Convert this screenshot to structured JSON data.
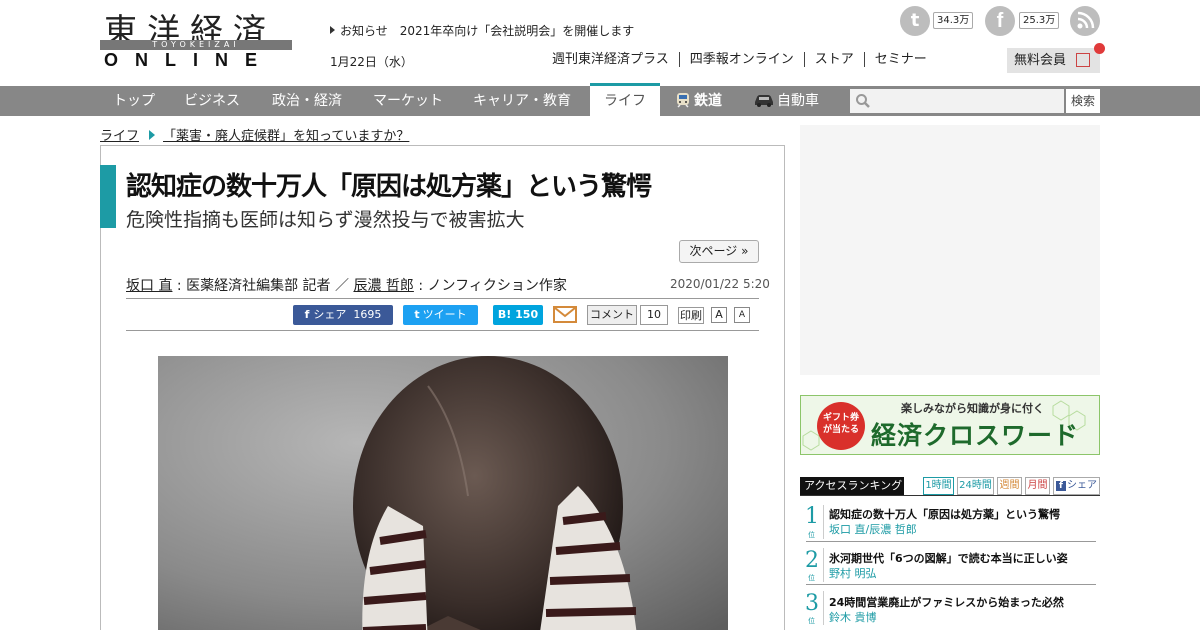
{
  "logo": {
    "kanji": "東洋経済",
    "roman": "TOYOKEIZAI",
    "online": "ONLINE"
  },
  "header": {
    "notice": "お知らせ　2021年卒向け「会社説明会」を開催します",
    "date": "1月22日（水）",
    "links": [
      "週刊東洋経済プラス",
      "四季報オンライン",
      "ストア",
      "セミナー"
    ],
    "member_button": "無料会員"
  },
  "social": [
    {
      "icon": "twitter-icon",
      "count": "34.3万"
    },
    {
      "icon": "facebook-icon",
      "count": "25.3万"
    },
    {
      "icon": "rss-icon",
      "count": ""
    }
  ],
  "nav": {
    "items": [
      "トップ",
      "ビジネス",
      "政治・経済",
      "マーケット",
      "キャリア・教育",
      "ライフ",
      "鉄道",
      "自動車"
    ],
    "active": "ライフ",
    "search_button": "検索"
  },
  "breadcrumb": {
    "section": "ライフ",
    "series": "「薬害・廃人症候群」を知っていますか？"
  },
  "article": {
    "title": "認知症の数十万人「原因は処方薬」という驚愕",
    "subtitle": "危険性指摘も医師は知らず漫然投与で被害拡大",
    "next_page": "次ページ »",
    "author1": "坂口 直",
    "author1_role": "医薬経済社編集部 記者",
    "separator": "／",
    "author2": "辰濃 哲郎",
    "author2_role": "ノンフィクション作家",
    "date": "2020/01/22 5:20"
  },
  "share": {
    "facebook_label": "シェア",
    "facebook_count": "1695",
    "tweet_label": "ツイート",
    "hatena_label": "B!",
    "hatena_count": "150",
    "comment_label": "コメント",
    "comment_count": "10",
    "print_label": "印刷",
    "font_large": "A",
    "font_small": "A"
  },
  "banner": {
    "tagline": "楽しみながら知識が身に付く",
    "badge": "ギフト券が当たる",
    "title": "経済クロスワード"
  },
  "ranking": {
    "header": "アクセスランキング",
    "tabs": [
      "1時間",
      "24時間",
      "週間",
      "月間",
      "シェア"
    ],
    "rank_suffix": "位",
    "items": [
      {
        "rank": "1",
        "title": "認知症の数十万人「原因は処方薬」という驚愕",
        "author": "坂口 直/辰濃 哲郎"
      },
      {
        "rank": "2",
        "title": "氷河期世代「6つの図解」で読む本当に正しい姿",
        "author": "野村 明弘"
      },
      {
        "rank": "3",
        "title": "24時間営業廃止がファミレスから始まった必然",
        "author": "鈴木 貴博"
      }
    ]
  },
  "colors": {
    "accent": "#1d9ba5",
    "nav_bg": "#878787",
    "facebook": "#3b5998",
    "twitter": "#1da1f2",
    "hatena": "#00a4de"
  }
}
